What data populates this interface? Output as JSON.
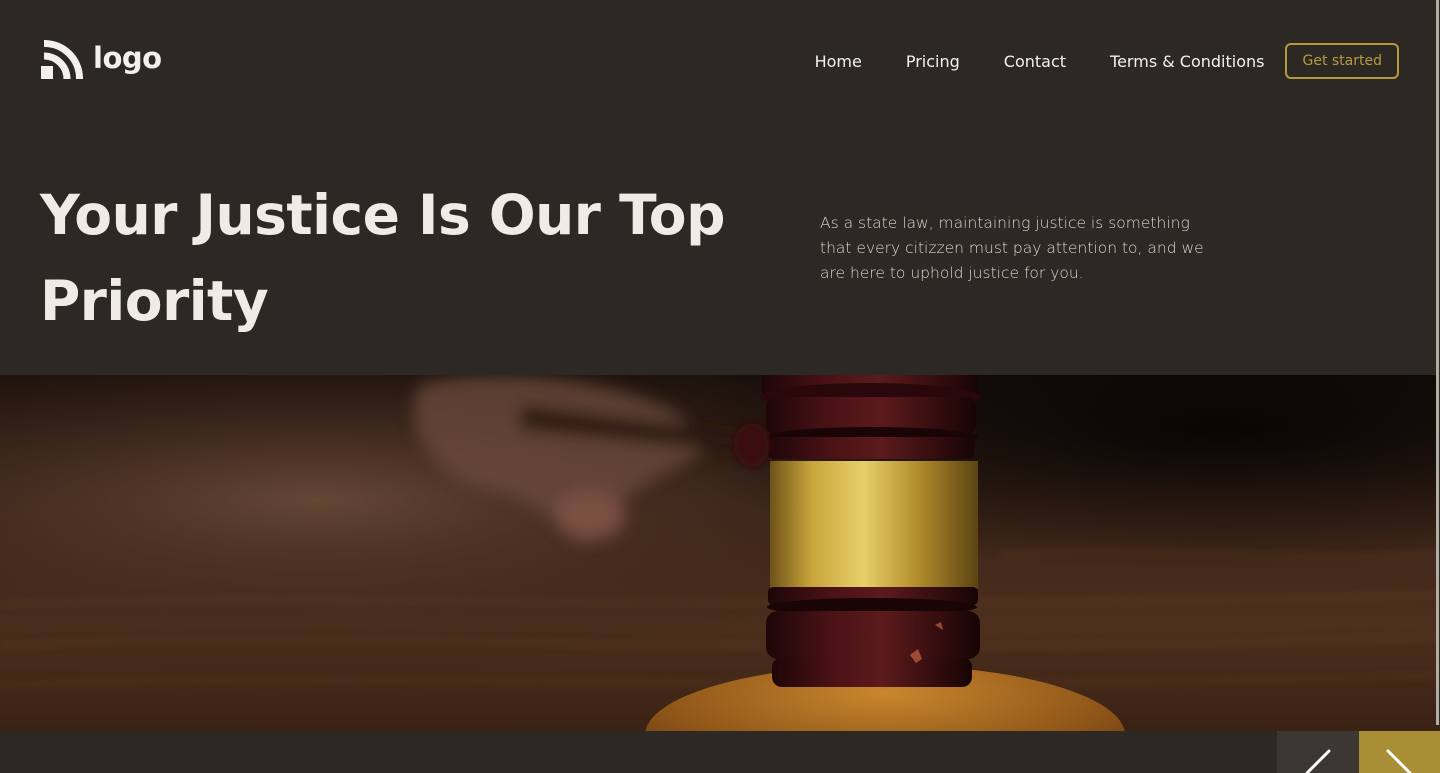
{
  "header": {
    "logo_text": "logo",
    "nav": {
      "home": "Home",
      "pricing": "Pricing",
      "contact": "Contact",
      "terms": "Terms & Conditions"
    },
    "cta_label": "Get started"
  },
  "hero": {
    "title": "Your Justice Is Our Top Priority",
    "description": "As a state law, maintaining justice is something that every citizzen must pay attention to, and we are here to uphold justice for you."
  },
  "image": {
    "subject": "gavel"
  },
  "slider": {
    "prev_icon": "chevron-left-icon",
    "next_icon": "chevron-right-icon"
  },
  "colors": {
    "background": "#2c2924",
    "accent": "#b79a3f",
    "next_button": "#a88f36",
    "prev_button": "#3b3833",
    "text": "#efece6"
  }
}
